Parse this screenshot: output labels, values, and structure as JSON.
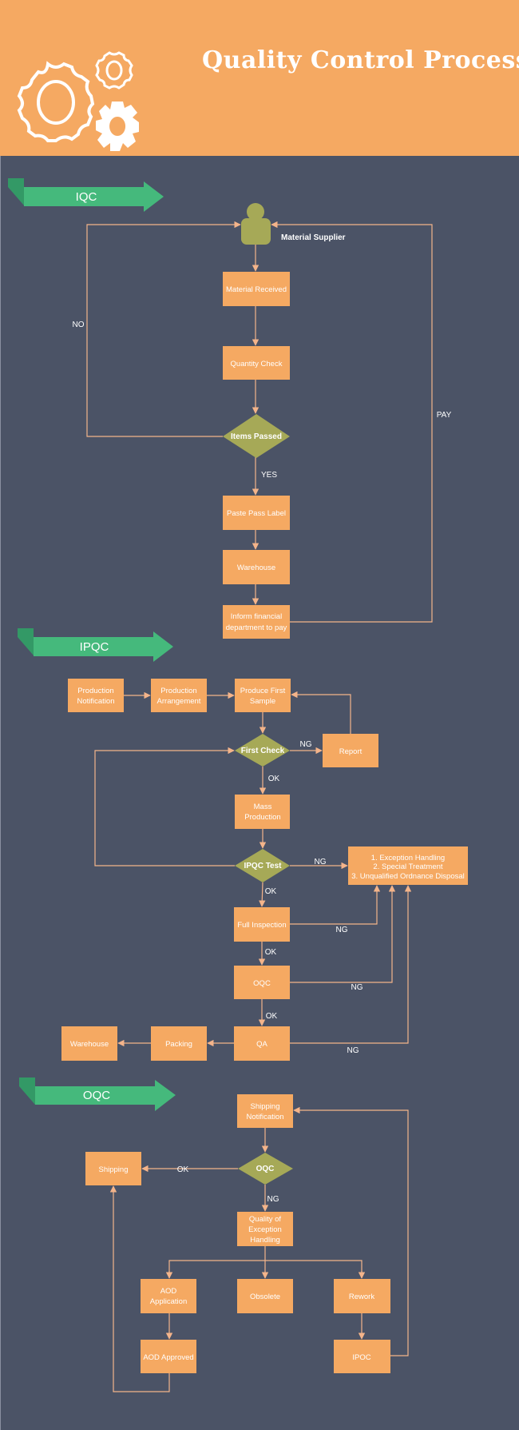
{
  "header": {
    "title": "Quality Control Process",
    "icon": "gears-icon",
    "background_color": "#f5a962"
  },
  "colors": {
    "canvas_background": "#4b5366",
    "process_box": "#f5a962",
    "decision": "#a6a957",
    "connector": "#f4b48a",
    "banner": "#45b97c",
    "banner_fold": "#339966",
    "text": "#ffffff"
  },
  "sections": {
    "iqc": {
      "banner": "IQC",
      "actor": "Material Supplier",
      "nodes": {
        "material_received": "Material Received",
        "quantity_check": "Quantity Check",
        "items_passed": "Items Passed",
        "paste_pass_label": "Paste Pass Label",
        "warehouse": "Warehouse",
        "inform_financial_1": "Inform financial",
        "inform_financial_2": "department to pay"
      },
      "labels": {
        "no": "NO",
        "yes": "YES",
        "pay": "PAY"
      }
    },
    "ipqc": {
      "banner": "IPQC",
      "nodes": {
        "production_notification_1": "Production",
        "production_notification_2": "Notification",
        "production_arrangement_1": "Production",
        "production_arrangement_2": "Arrangement",
        "produce_first_sample_1": "Produce First",
        "produce_first_sample_2": "Sample",
        "first_check": "First Check",
        "report": "Report",
        "mass_production_1": "Mass",
        "mass_production_2": "Production",
        "ipqc_test": "IPQC Test",
        "exception_1": "1. Exception Handling",
        "exception_2": "2. Special  Treatment",
        "exception_3": "3. Unqualified Ordnance Disposal",
        "full_inspection": "Full Inspection",
        "oqc": "OQC",
        "qa": "QA",
        "packing": "Packing",
        "warehouse": "Warehouse"
      },
      "labels": {
        "first_check_ng": "NG",
        "first_check_ok": "OK",
        "ipqc_test_ng": "NG",
        "ipqc_test_ok": "OK",
        "full_inspection_ng": "NG",
        "full_inspection_ok": "OK",
        "oqc_ng": "NG",
        "oqc_ok": "OK",
        "qa_ng": "NG"
      }
    },
    "oqc": {
      "banner": "OQC",
      "nodes": {
        "shipping_notification_1": "Shipping",
        "shipping_notification_2": "Notification",
        "oqc": "OQC",
        "shipping": "Shipping",
        "quality_exception_1": "Quality of",
        "quality_exception_2": "Exception",
        "quality_exception_3": "Handling",
        "aod_application_1": "AOD",
        "aod_application_2": "Application",
        "obsolete": "Obsolete",
        "rework": "Rework",
        "aod_approved": "AOD Approved",
        "ipoc": "IPOC"
      },
      "labels": {
        "ok": "OK",
        "ng": "NG"
      }
    }
  }
}
